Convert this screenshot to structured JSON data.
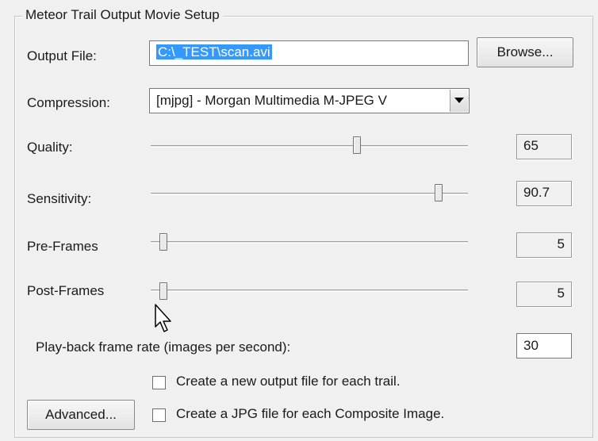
{
  "group_title": "Meteor Trail Output Movie Setup",
  "output_file": {
    "label": "Output File:",
    "value": "C:\\_TEST\\scan.avi",
    "browse_label": "Browse..."
  },
  "compression": {
    "label": "Compression:",
    "selected": "[mjpg] - Morgan Multimedia M-JPEG V"
  },
  "quality": {
    "label": "Quality:",
    "value": "65",
    "level": 0.65
  },
  "sensitivity": {
    "label": "Sensitivity:",
    "value": "90.7",
    "level": 0.907
  },
  "pre_frames": {
    "label": "Pre-Frames",
    "value": "5",
    "level": 0.04
  },
  "post_frames": {
    "label": "Post-Frames",
    "value": "5",
    "level": 0.04
  },
  "playback": {
    "label": "Play-back frame rate (images per second):",
    "value": "30"
  },
  "checkbox_new_file": {
    "label": "Create a new output file for each trail.",
    "checked": false
  },
  "checkbox_jpg": {
    "label": "Create a JPG file for each Composite Image.",
    "checked": false
  },
  "advanced_label": "Advanced...",
  "icons": {
    "combo_arrow": "chevron-down-icon",
    "cursor": "mouse-pointer-icon"
  }
}
